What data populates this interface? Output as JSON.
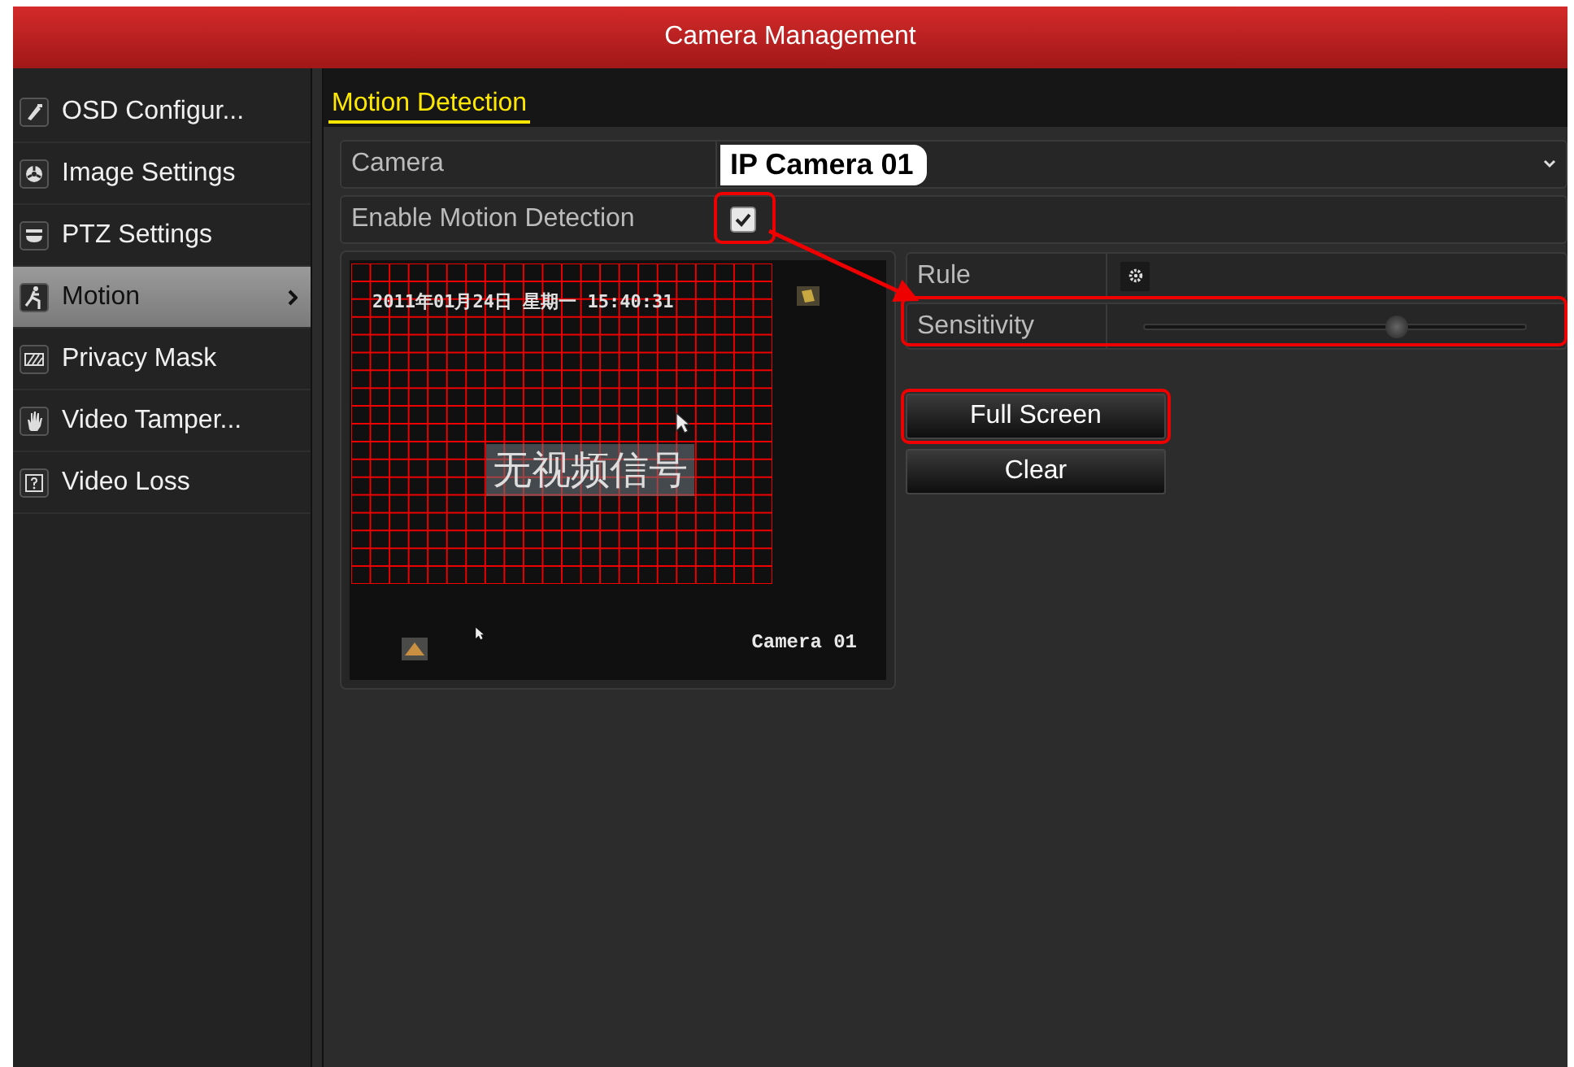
{
  "window": {
    "title": "Camera Management"
  },
  "sidebar": {
    "items": [
      {
        "label": "OSD Configur...",
        "selected": false
      },
      {
        "label": "Image Settings",
        "selected": false
      },
      {
        "label": "PTZ Settings",
        "selected": false
      },
      {
        "label": "Motion",
        "selected": true
      },
      {
        "label": "Privacy Mask",
        "selected": false
      },
      {
        "label": "Video Tamper...",
        "selected": false
      },
      {
        "label": "Video Loss",
        "selected": false
      }
    ]
  },
  "tabs": [
    {
      "label": "Motion Detection",
      "selected": true
    }
  ],
  "camera": {
    "label": "Camera",
    "value": "IP Camera 01"
  },
  "enable": {
    "label": "Enable Motion Detection",
    "checked": true
  },
  "preview": {
    "timestamp": "2011年01月24日 星期一 15:40:31",
    "status": "无视频信号",
    "channel": "Camera 01"
  },
  "rule": {
    "label": "Rule"
  },
  "sensitivity": {
    "label": "Sensitivity",
    "level": 0.66
  },
  "buttons": [
    {
      "label": "Full Screen",
      "highlighted": true
    },
    {
      "label": "Clear",
      "highlighted": false
    }
  ]
}
